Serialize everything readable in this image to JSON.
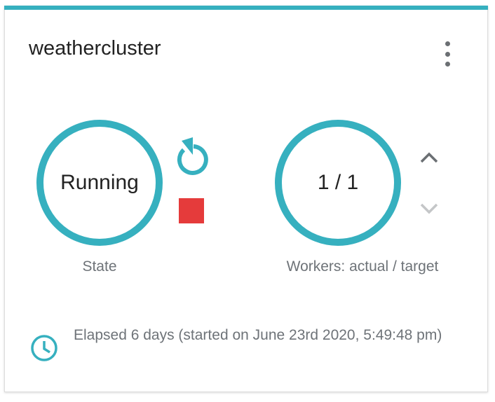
{
  "card": {
    "title": "weathercluster",
    "menu_icon": "more-vert-icon",
    "accent_color": "#36b0bf"
  },
  "state": {
    "value": "Running",
    "label": "State",
    "restart_icon": "restart-icon",
    "stop_icon": "stop-icon",
    "stop_color": "#e53b3b"
  },
  "workers": {
    "value": "1 / 1",
    "label": "Workers: actual / target",
    "increase_icon": "chevron-up-icon",
    "decrease_icon": "chevron-down-icon"
  },
  "elapsed": {
    "icon": "clock-icon",
    "text": "Elapsed 6 days (started on June 23rd 2020, 5:49:48 pm)"
  }
}
